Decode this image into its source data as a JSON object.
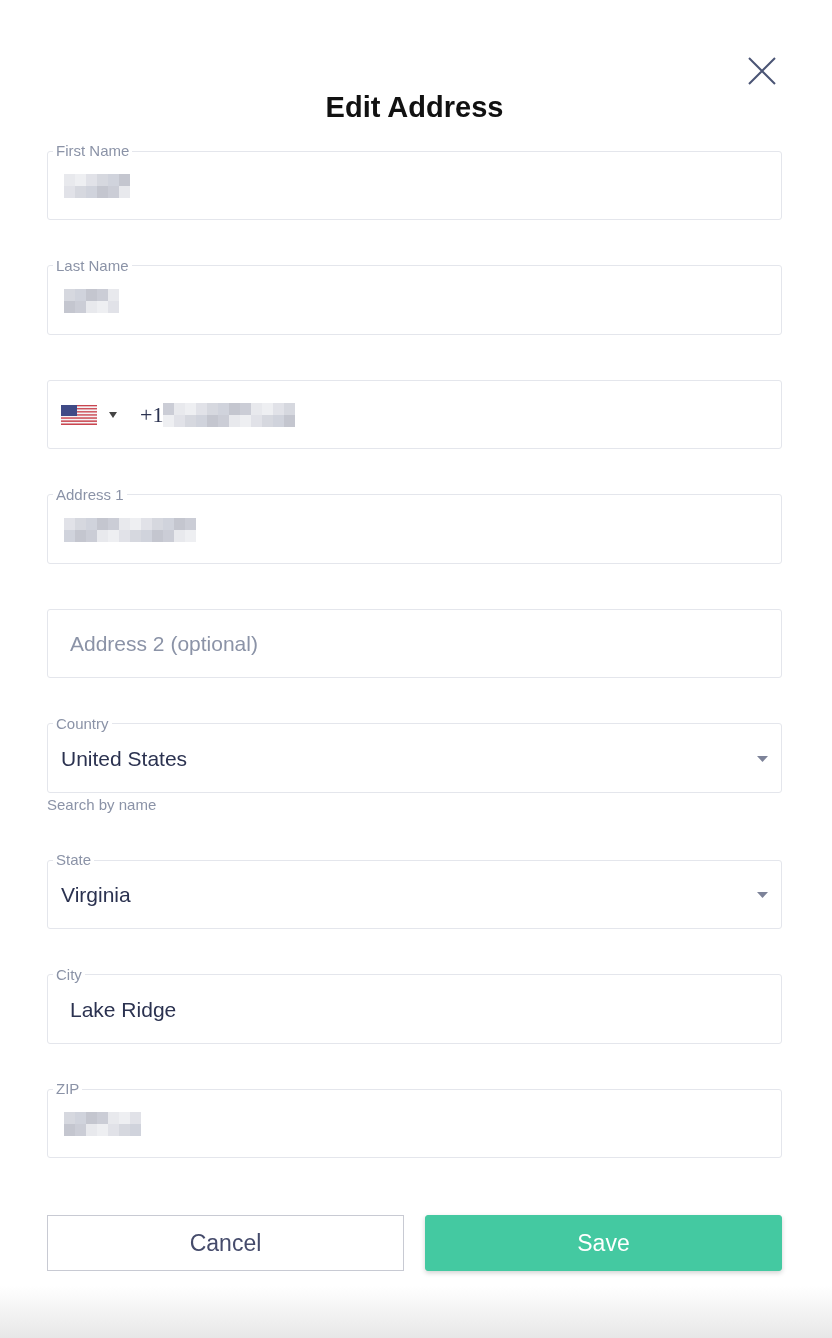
{
  "dialog": {
    "title": "Edit Address"
  },
  "fields": [
    {
      "kind": "text",
      "label": "First Name",
      "redacted": true
    },
    {
      "kind": "text",
      "label": "Last Name",
      "redacted": true
    },
    {
      "kind": "phone",
      "value": "+1",
      "redacted": true
    },
    {
      "kind": "text",
      "label": "Address 1",
      "redacted": true
    },
    {
      "kind": "text",
      "placeholder": "Address 2 (optional)",
      "redacted": false
    },
    {
      "kind": "select",
      "label": "Country",
      "value": "United States",
      "helper": "Search by name",
      "redacted": false
    },
    {
      "kind": "select",
      "label": "State",
      "value": "Virginia",
      "redacted": false
    },
    {
      "kind": "text",
      "label": "City",
      "value": "Lake Ridge",
      "redacted": false
    },
    {
      "kind": "text",
      "label": "ZIP",
      "redacted": true
    }
  ],
  "buttons": [
    {
      "kind": "secondary",
      "label": "Cancel"
    },
    {
      "kind": "primary",
      "label": "Save"
    }
  ]
}
